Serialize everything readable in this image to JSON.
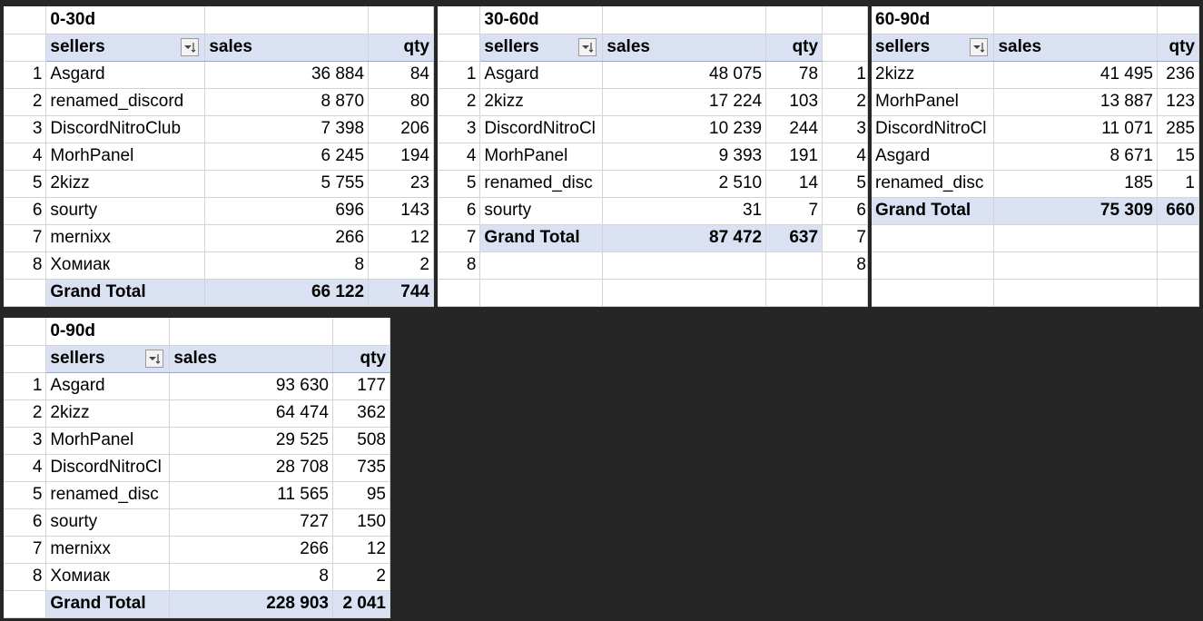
{
  "pivots": [
    {
      "title": "0-30d",
      "headers": {
        "sellers": "sellers",
        "sales": "sales",
        "qty": "qty"
      },
      "rows": [
        {
          "idx": "1",
          "seller": "Asgard",
          "sales": "36 884",
          "qty": "84"
        },
        {
          "idx": "2",
          "seller": "renamed_discord",
          "sales": "8 870",
          "qty": "80"
        },
        {
          "idx": "3",
          "seller": "DiscordNitroClub",
          "sales": "7 398",
          "qty": "206"
        },
        {
          "idx": "4",
          "seller": "MorhPanel",
          "sales": "6 245",
          "qty": "194"
        },
        {
          "idx": "5",
          "seller": "2kizz",
          "sales": "5 755",
          "qty": "23"
        },
        {
          "idx": "6",
          "seller": "sourty",
          "sales": "696",
          "qty": "143"
        },
        {
          "idx": "7",
          "seller": "mernixx",
          "sales": "266",
          "qty": "12"
        },
        {
          "idx": "8",
          "seller": "Хомиак",
          "sales": "8",
          "qty": "2"
        }
      ],
      "total": {
        "label": "Grand Total",
        "sales": "66 122",
        "qty": "744"
      }
    },
    {
      "title": "30-60d",
      "headers": {
        "sellers": "sellers",
        "sales": "sales",
        "qty": "qty"
      },
      "rows": [
        {
          "idx": "1",
          "seller": "Asgard",
          "sales": "48 075",
          "qty": "78"
        },
        {
          "idx": "2",
          "seller": "2kizz",
          "sales": "17 224",
          "qty": "103"
        },
        {
          "idx": "3",
          "seller": "DiscordNitroCl",
          "sales": "10 239",
          "qty": "244"
        },
        {
          "idx": "4",
          "seller": "MorhPanel",
          "sales": "9 393",
          "qty": "191"
        },
        {
          "idx": "5",
          "seller": "renamed_disc",
          "sales": "2 510",
          "qty": "14"
        },
        {
          "idx": "6",
          "seller": "sourty",
          "sales": "31",
          "qty": "7"
        }
      ],
      "total": {
        "label": "Grand Total",
        "sales": "87 472",
        "qty": "637"
      },
      "total_idx": "7",
      "extra_idx": [
        "8"
      ]
    },
    {
      "title": "60-90d",
      "headers": {
        "sellers": "sellers",
        "sales": "sales",
        "qty": "qty"
      },
      "rows": [
        {
          "idx": "1",
          "seller": "2kizz",
          "sales": "41 495",
          "qty": "236"
        },
        {
          "idx": "2",
          "seller": "MorhPanel",
          "sales": "13 887",
          "qty": "123"
        },
        {
          "idx": "3",
          "seller": "DiscordNitroCl",
          "sales": "11 071",
          "qty": "285"
        },
        {
          "idx": "4",
          "seller": "Asgard",
          "sales": "8 671",
          "qty": "15"
        },
        {
          "idx": "5",
          "seller": "renamed_disc",
          "sales": "185",
          "qty": "1"
        }
      ],
      "total": {
        "label": "Grand Total",
        "sales": "75 309",
        "qty": "660"
      },
      "total_idx": "6",
      "extra_idx": [
        "7",
        "8"
      ]
    },
    {
      "title": "0-90d",
      "headers": {
        "sellers": "sellers",
        "sales": "sales",
        "qty": "qty"
      },
      "rows": [
        {
          "idx": "1",
          "seller": "Asgard",
          "sales": "93 630",
          "qty": "177"
        },
        {
          "idx": "2",
          "seller": "2kizz",
          "sales": "64 474",
          "qty": "362"
        },
        {
          "idx": "3",
          "seller": "MorhPanel",
          "sales": "29 525",
          "qty": "508"
        },
        {
          "idx": "4",
          "seller": "DiscordNitroCl",
          "sales": "28 708",
          "qty": "735"
        },
        {
          "idx": "5",
          "seller": "renamed_disc",
          "sales": "11 565",
          "qty": "95"
        },
        {
          "idx": "6",
          "seller": "sourty",
          "sales": "727",
          "qty": "150"
        },
        {
          "idx": "7",
          "seller": "mernixx",
          "sales": "266",
          "qty": "12"
        },
        {
          "idx": "8",
          "seller": "Хомиак",
          "sales": "8",
          "qty": "2"
        }
      ],
      "total": {
        "label": "Grand Total",
        "sales": "228 903",
        "qty": "2 041"
      }
    }
  ],
  "colors": {
    "background": "#262626",
    "header_fill": "#d9e1f2",
    "header_border": "#8ea9db",
    "gridline": "#d4d4d4"
  },
  "icons": {
    "filter": "filter-sort-dropdown-icon"
  }
}
